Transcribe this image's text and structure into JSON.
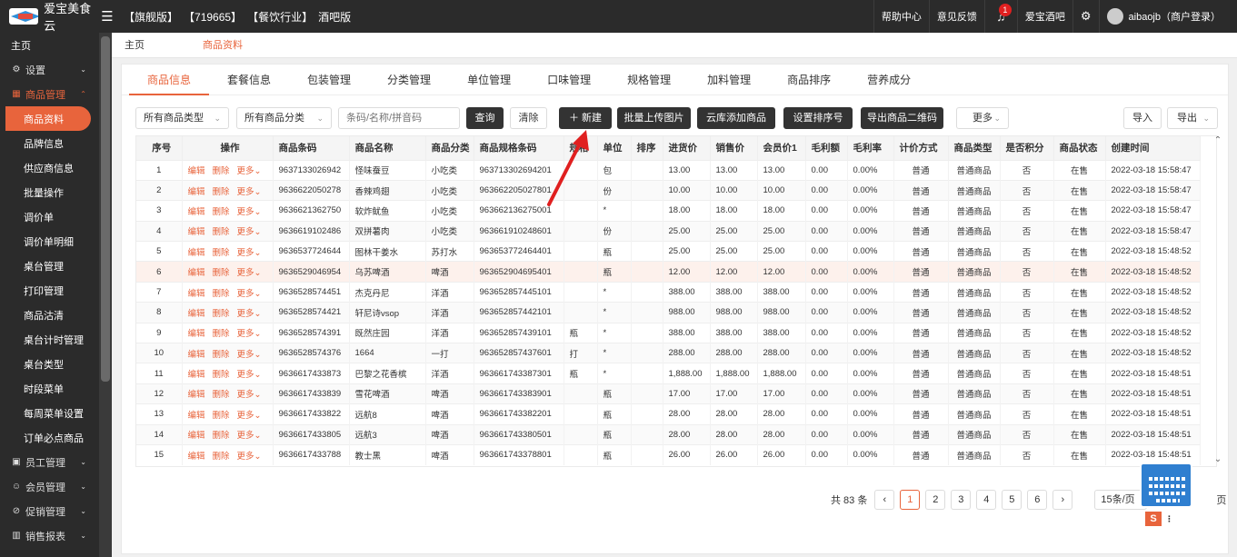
{
  "app": {
    "name": "爱宝美食云",
    "tags": [
      "【旗舰版】",
      "【719665】",
      "【餐饮行业】",
      "酒吧版"
    ]
  },
  "header": {
    "help": "帮助中心",
    "feedback": "意见反馈",
    "notif_count": "1",
    "store": "爱宝酒吧",
    "user": "aibaojb（商户登录）"
  },
  "sidebar": [
    {
      "label": "主页",
      "type": "top"
    },
    {
      "label": "设置",
      "type": "group",
      "icon": "⚙"
    },
    {
      "label": "商品管理",
      "type": "open",
      "icon": "▦"
    },
    {
      "label": "商品资料",
      "type": "active"
    },
    {
      "label": "品牌信息",
      "type": "sub"
    },
    {
      "label": "供应商信息",
      "type": "sub"
    },
    {
      "label": "批量操作",
      "type": "sub"
    },
    {
      "label": "调价单",
      "type": "sub"
    },
    {
      "label": "调价单明细",
      "type": "sub"
    },
    {
      "label": "桌台管理",
      "type": "sub"
    },
    {
      "label": "打印管理",
      "type": "sub"
    },
    {
      "label": "商品沽清",
      "type": "sub"
    },
    {
      "label": "桌台计时管理",
      "type": "sub"
    },
    {
      "label": "桌台类型",
      "type": "sub"
    },
    {
      "label": "时段菜单",
      "type": "sub"
    },
    {
      "label": "每周菜单设置",
      "type": "sub"
    },
    {
      "label": "订单必点商品",
      "type": "sub"
    },
    {
      "label": "员工管理",
      "type": "group",
      "icon": "▣"
    },
    {
      "label": "会员管理",
      "type": "group",
      "icon": "☺"
    },
    {
      "label": "促销管理",
      "type": "group",
      "icon": "⊘"
    },
    {
      "label": "销售报表",
      "type": "group",
      "icon": "▥"
    }
  ],
  "page_tabs": [
    "主页",
    "商品资料"
  ],
  "sub_tabs": [
    "商品信息",
    "套餐信息",
    "包装管理",
    "分类管理",
    "单位管理",
    "口味管理",
    "规格管理",
    "加料管理",
    "商品排序",
    "营养成分"
  ],
  "filters": {
    "type_select": "所有商品类型",
    "category_select": "所有商品分类",
    "search_placeholder": "条码/名称/拼音码",
    "query": "查询",
    "clear": "清除",
    "new": "＋ 新建",
    "batch_upload": "批量上传图片",
    "cloud_add": "云库添加商品",
    "set_sort": "设置排序号",
    "export_qr": "导出商品二维码",
    "more": "更多",
    "import": "导入",
    "export": "导出"
  },
  "table": {
    "columns": [
      "序号",
      "操作",
      "商品条码",
      "商品名称",
      "商品分类",
      "商品规格条码",
      "规格",
      "单位",
      "排序",
      "进货价",
      "销售价",
      "会员价1",
      "毛利额",
      "毛利率",
      "计价方式",
      "商品类型",
      "是否积分",
      "商品状态",
      "创建时间"
    ],
    "op_labels": [
      "编辑",
      "删除",
      "更多"
    ],
    "rows": [
      [
        "1",
        "9637133026942",
        "怪味蚕豆",
        "小吃类",
        "963713302694201",
        "",
        "包",
        "",
        "13.00",
        "13.00",
        "13.00",
        "0.00",
        "0.00%",
        "普通",
        "普通商品",
        "否",
        "在售",
        "2022-03-18 15:58:47"
      ],
      [
        "2",
        "9636622050278",
        "香辣鸡翅",
        "小吃类",
        "963662205027801",
        "",
        "份",
        "",
        "10.00",
        "10.00",
        "10.00",
        "0.00",
        "0.00%",
        "普通",
        "普通商品",
        "否",
        "在售",
        "2022-03-18 15:58:47"
      ],
      [
        "3",
        "9636621362750",
        "软炸鱿鱼",
        "小吃类",
        "963662136275001",
        "",
        "*",
        "",
        "18.00",
        "18.00",
        "18.00",
        "0.00",
        "0.00%",
        "普通",
        "普通商品",
        "否",
        "在售",
        "2022-03-18 15:58:47"
      ],
      [
        "4",
        "9636619102486",
        "双拼薯肉",
        "小吃类",
        "963661910248601",
        "",
        "份",
        "",
        "25.00",
        "25.00",
        "25.00",
        "0.00",
        "0.00%",
        "普通",
        "普通商品",
        "否",
        "在售",
        "2022-03-18 15:58:47"
      ],
      [
        "5",
        "9636537724644",
        "图林干姜水",
        "苏打水",
        "963653772464401",
        "",
        "瓶",
        "",
        "25.00",
        "25.00",
        "25.00",
        "0.00",
        "0.00%",
        "普通",
        "普通商品",
        "否",
        "在售",
        "2022-03-18 15:48:52"
      ],
      [
        "6",
        "9636529046954",
        "乌苏啤酒",
        "啤酒",
        "963652904695401",
        "",
        "瓶",
        "",
        "12.00",
        "12.00",
        "12.00",
        "0.00",
        "0.00%",
        "普通",
        "普通商品",
        "否",
        "在售",
        "2022-03-18 15:48:52"
      ],
      [
        "7",
        "9636528574451",
        "杰克丹尼",
        "洋酒",
        "963652857445101",
        "",
        "*",
        "",
        "388.00",
        "388.00",
        "388.00",
        "0.00",
        "0.00%",
        "普通",
        "普通商品",
        "否",
        "在售",
        "2022-03-18 15:48:52"
      ],
      [
        "8",
        "9636528574421",
        "轩尼诗vsop",
        "洋酒",
        "963652857442101",
        "",
        "*",
        "",
        "988.00",
        "988.00",
        "988.00",
        "0.00",
        "0.00%",
        "普通",
        "普通商品",
        "否",
        "在售",
        "2022-03-18 15:48:52"
      ],
      [
        "9",
        "9636528574391",
        "既然庄园",
        "洋酒",
        "963652857439101",
        "瓶",
        "*",
        "",
        "388.00",
        "388.00",
        "388.00",
        "0.00",
        "0.00%",
        "普通",
        "普通商品",
        "否",
        "在售",
        "2022-03-18 15:48:52"
      ],
      [
        "10",
        "9636528574376",
        "1664",
        "一打",
        "963652857437601",
        "打",
        "*",
        "",
        "288.00",
        "288.00",
        "288.00",
        "0.00",
        "0.00%",
        "普通",
        "普通商品",
        "否",
        "在售",
        "2022-03-18 15:48:52"
      ],
      [
        "11",
        "9636617433873",
        "巴黎之花香槟",
        "洋酒",
        "963661743387301",
        "瓶",
        "*",
        "",
        "1,888.00",
        "1,888.00",
        "1,888.00",
        "0.00",
        "0.00%",
        "普通",
        "普通商品",
        "否",
        "在售",
        "2022-03-18 15:48:51"
      ],
      [
        "12",
        "9636617433839",
        "雪花啤酒",
        "啤酒",
        "963661743383901",
        "",
        "瓶",
        "",
        "17.00",
        "17.00",
        "17.00",
        "0.00",
        "0.00%",
        "普通",
        "普通商品",
        "否",
        "在售",
        "2022-03-18 15:48:51"
      ],
      [
        "13",
        "9636617433822",
        "远航8",
        "啤酒",
        "963661743382201",
        "",
        "瓶",
        "",
        "28.00",
        "28.00",
        "28.00",
        "0.00",
        "0.00%",
        "普通",
        "普通商品",
        "否",
        "在售",
        "2022-03-18 15:48:51"
      ],
      [
        "14",
        "9636617433805",
        "远航3",
        "啤酒",
        "963661743380501",
        "",
        "瓶",
        "",
        "28.00",
        "28.00",
        "28.00",
        "0.00",
        "0.00%",
        "普通",
        "普通商品",
        "否",
        "在售",
        "2022-03-18 15:48:51"
      ],
      [
        "15",
        "9636617433788",
        "教士黑",
        "啤酒",
        "963661743378801",
        "",
        "瓶",
        "",
        "26.00",
        "26.00",
        "26.00",
        "0.00",
        "0.00%",
        "普通",
        "普通商品",
        "否",
        "在售",
        "2022-03-18 15:48:51"
      ]
    ]
  },
  "pager": {
    "total": "共 83 条",
    "pages": [
      "1",
      "2",
      "3",
      "4",
      "5",
      "6"
    ],
    "size": "15条/页",
    "goto": "页"
  }
}
